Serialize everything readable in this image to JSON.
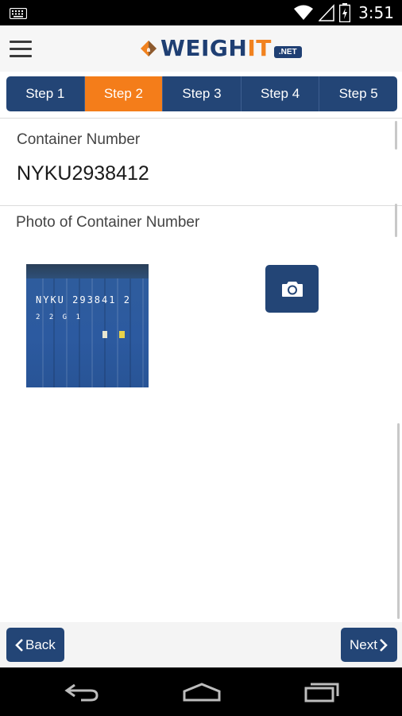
{
  "status_bar": {
    "time": "3:51",
    "icons": [
      "keyboard-icon",
      "wifi-icon",
      "signal-icon",
      "battery-icon"
    ]
  },
  "app_bar": {
    "logo_text_main": "WEIGH",
    "logo_text_accent": "IT",
    "logo_suffix": ".NET",
    "menu_icon": "hamburger-menu-icon"
  },
  "steps": {
    "active_index": 1,
    "items": [
      {
        "label": "Step 1"
      },
      {
        "label": "Step 2"
      },
      {
        "label": "Step 3"
      },
      {
        "label": "Step 4"
      },
      {
        "label": "Step 5"
      }
    ]
  },
  "form": {
    "container_number_label": "Container Number",
    "container_number_value": "NYKU2938412",
    "photo_label": "Photo of Container Number",
    "photo_container_marking": "NYKU 293841 2",
    "photo_container_code": "2 2 G 1",
    "camera_icon": "camera-icon"
  },
  "footer": {
    "back_label": "Back",
    "next_label": "Next"
  },
  "nav_bar": {
    "icons": [
      "back-nav-icon",
      "home-nav-icon",
      "recents-nav-icon"
    ]
  },
  "colors": {
    "primary": "#234576",
    "accent": "#f47d1a",
    "logo_blue": "#1f3f73",
    "logo_orange": "#f1821f"
  }
}
